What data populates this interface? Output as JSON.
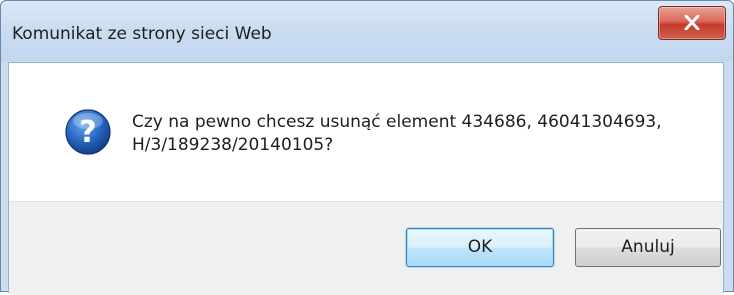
{
  "window": {
    "title": "Komunikat ze strony sieci Web",
    "close_icon": "close-icon"
  },
  "dialog": {
    "icon": "question-icon",
    "message_line1": "Czy na pewno chcesz usunąć element 434686, 46041304693,",
    "message_line2": "H/3/189238/20140105?"
  },
  "buttons": {
    "ok_label": "OK",
    "cancel_label": "Anuluj"
  },
  "colors": {
    "close_button": "#c23a2b",
    "titlebar": "#cadcf1",
    "default_button_border": "#3c7fb1",
    "icon_blue": "#1f5fb5"
  }
}
